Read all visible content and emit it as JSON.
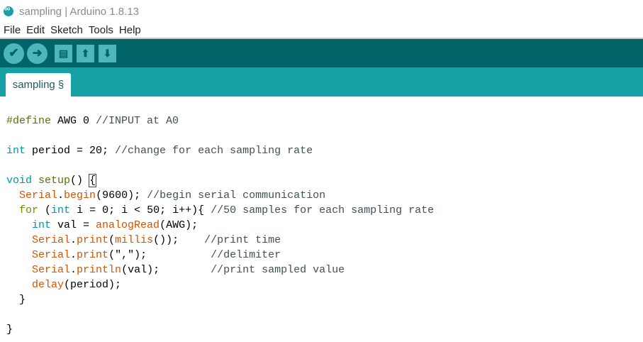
{
  "window": {
    "title": "sampling | Arduino 1.8.13"
  },
  "menu": [
    "File",
    "Edit",
    "Sketch",
    "Tools",
    "Help"
  ],
  "toolbar": {
    "verify": "✔",
    "upload": "➜",
    "new": "▤",
    "open": "⬆",
    "save": "⬇"
  },
  "tab": {
    "label": "sampling §"
  },
  "colors": {
    "toolbar": "#006468",
    "tabbar": "#17a1a5",
    "button": "#4db7bb",
    "keyword": "#00979c",
    "function": "#d35400"
  },
  "code": [
    [
      [
        "pre",
        "#define"
      ],
      [
        "plain",
        " AWG 0 "
      ],
      [
        "cmt",
        "//INPUT at A0"
      ]
    ],
    [],
    [
      [
        "type",
        "int"
      ],
      [
        "plain",
        " period = 20; "
      ],
      [
        "cmt",
        "//change for each sampling rate"
      ]
    ],
    [],
    [
      [
        "type",
        "void"
      ],
      [
        "plain",
        " "
      ],
      [
        "fn",
        "setup"
      ],
      [
        "plain",
        "() "
      ],
      [
        "cur",
        "{"
      ]
    ],
    [
      [
        "plain",
        "  "
      ],
      [
        "lib",
        "Serial"
      ],
      [
        "plain",
        "."
      ],
      [
        "lib",
        "begin"
      ],
      [
        "plain",
        "(9600); "
      ],
      [
        "cmt",
        "//begin serial communication"
      ]
    ],
    [
      [
        "plain",
        "  "
      ],
      [
        "ctrl",
        "for"
      ],
      [
        "plain",
        " ("
      ],
      [
        "type",
        "int"
      ],
      [
        "plain",
        " i = 0; i < 50; i++){ "
      ],
      [
        "cmt",
        "//50 samples for each sampling rate"
      ]
    ],
    [
      [
        "plain",
        "    "
      ],
      [
        "type",
        "int"
      ],
      [
        "plain",
        " val = "
      ],
      [
        "lib",
        "analogRead"
      ],
      [
        "plain",
        "(AWG);"
      ]
    ],
    [
      [
        "plain",
        "    "
      ],
      [
        "lib",
        "Serial"
      ],
      [
        "plain",
        "."
      ],
      [
        "lib",
        "print"
      ],
      [
        "plain",
        "("
      ],
      [
        "lib",
        "millis"
      ],
      [
        "plain",
        "());    "
      ],
      [
        "cmt",
        "//print time"
      ]
    ],
    [
      [
        "plain",
        "    "
      ],
      [
        "lib",
        "Serial"
      ],
      [
        "plain",
        "."
      ],
      [
        "lib",
        "print"
      ],
      [
        "plain",
        "(\",\");          "
      ],
      [
        "cmt",
        "//delimiter"
      ]
    ],
    [
      [
        "plain",
        "    "
      ],
      [
        "lib",
        "Serial"
      ],
      [
        "plain",
        "."
      ],
      [
        "lib",
        "println"
      ],
      [
        "plain",
        "(val);        "
      ],
      [
        "cmt",
        "//print sampled value"
      ]
    ],
    [
      [
        "plain",
        "    "
      ],
      [
        "lib",
        "delay"
      ],
      [
        "plain",
        "(period);"
      ]
    ],
    [
      [
        "plain",
        "  }"
      ]
    ],
    [],
    [
      [
        "plain",
        "}"
      ]
    ]
  ]
}
